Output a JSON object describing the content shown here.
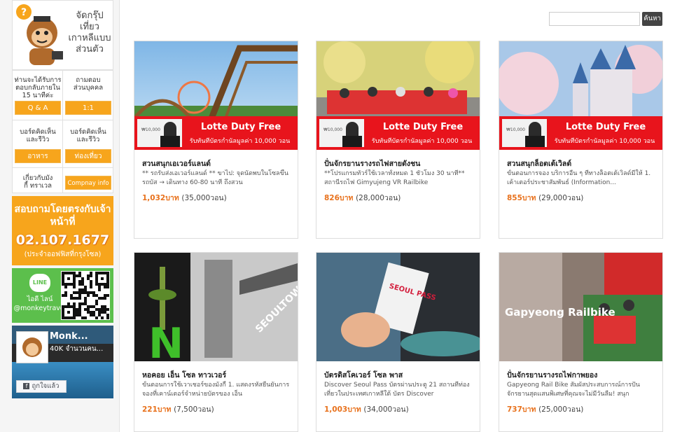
{
  "sidebar": {
    "logo_title": "จัดกรุ๊ปเที่ยวเกาหลีแบบส่วนตัว",
    "qa": {
      "text": "ท่านจะได้รับการตอบกลับภายใน 15 นาทีค่ะ",
      "button": "Q & A"
    },
    "one_on_one": {
      "text": "ถามตอบส่วนบุคคล",
      "button": "1:1"
    },
    "food_board": {
      "text": "บอร์ดคิดเห็นและรีวิว",
      "button": "อาหาร"
    },
    "travel_board": {
      "text": "บอร์ดคิดเห็นและรีวิว",
      "button": "ท่องเที่ยว"
    },
    "about": {
      "text": "เกี่ยวกับมังกี้ ทราเวล",
      "button": "Compnay info"
    },
    "call": {
      "title": "สอบถามโดยตรงกับเจ้าหน้าที่",
      "phone": "02.107.1677",
      "sub": "(ประจำออฟฟิสที่กรุงโซล)"
    },
    "line": {
      "badge": "LINE",
      "label1": "ไอดี ไลน์",
      "label2": "@monkeytravel"
    },
    "facebook": {
      "name": "Monk...",
      "count": "40K จำนวนคน...",
      "like": "ถูกใจแล้ว"
    }
  },
  "search": {
    "button": "ค้นหา",
    "placeholder": ""
  },
  "products": [
    {
      "title": "สวนสนุกเอเวอร์แลนด์",
      "desc": "** รถรับส่งเอเวอร์แลนด์ ** ขาไป: จุดนัดพบในโซลขึ้นรถบัส → เดินทาง 60-80 นาที ถึงสวน",
      "price": "1,032บาท",
      "won": "(35,000วอน)"
    },
    {
      "title": "ปั่นจักรยานรางรถไฟสายดังชน",
      "desc": "**โปรแกรมทัวร์ใช้เวลาทั้งหมด 1 ชั่วโมง 30 นาที** สถานีรถไฟ Gimyujeng VR Railbike",
      "price": "826บาท",
      "won": "(28,000วอน)"
    },
    {
      "title": "สวนสนุกล็อตเต้เวิลด์",
      "desc": "ขั้นตอนการจอง บริการอื่น ๆ ที่ทางล็อตเต้เวิลด์มีให้ 1. เค้าเตอร์ประชาสัมพันธ์ (Information...",
      "price": "855บาท",
      "won": "(29,000วอน)"
    },
    {
      "title": "หอคอย เอ็น โซล ทาวเวอร์",
      "desc": "ขั้นตอนการใช้เวาเชอร์ของมังกี้ 1. แสดงรหัสยืนยันการจองที่เคาน์เตอร์จำหน่ายบัตรของ เอ็น",
      "price": "221บาท",
      "won": "(7,500วอน)"
    },
    {
      "title": "บัตรดิสโคเวอร์ โซล พาส",
      "desc": "Discover Seoul Pass บัตรผ่านประตู 21 สถานที่ท่องเที่ยวในประเทศเกาหลีใต้ บัตร Discover",
      "price": "1,003บาท",
      "won": "(34,000วอน)"
    },
    {
      "title": "ปั่นจักรยานรางรถไฟกาพยอง",
      "desc": "Gapyeong Rail Bike สัมผัสประสบการณ์การปั่นจักรยานสุดแสนพิเศษที่คุณจะไม่มีวันลืม! สนุก",
      "price": "737บาท",
      "won": "(25,000วอน)"
    }
  ],
  "ad": {
    "title": "Lotte Duty Free",
    "sub": "รับทันทีบัตรกำนัลมูลค่า 10,000 วอน",
    "price_tag": "₩10,000"
  },
  "image_text": {
    "tower": "SEOULTOWER",
    "pass": "SEOUL PASS",
    "railbike": "Gapyeong Railbike"
  },
  "colors": {
    "orange": "#f7a51c",
    "red": "#e8141c",
    "line_green": "#5cbf4c",
    "price": "#e8711c"
  }
}
